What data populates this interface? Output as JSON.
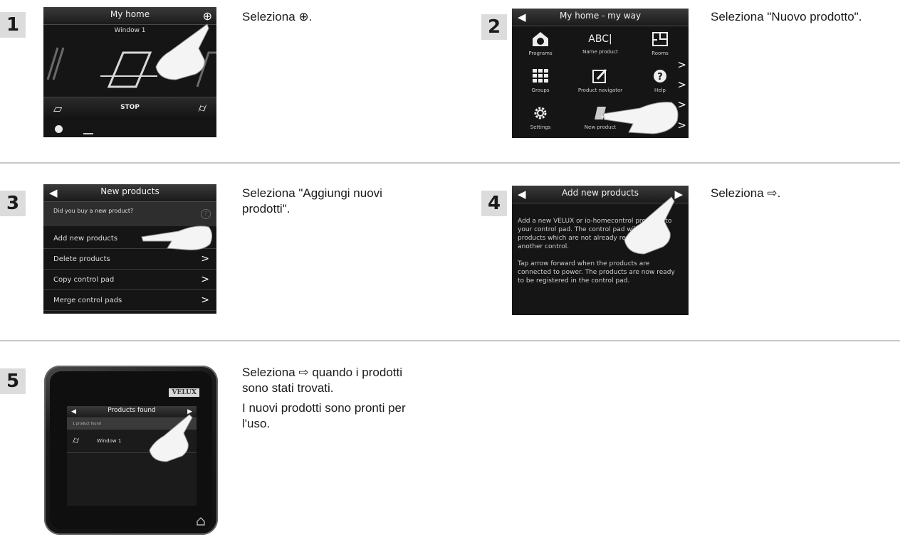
{
  "steps": [
    {
      "number": "1",
      "screen": {
        "title": "My home",
        "subtitle": "Window 1",
        "stop": "STOP"
      },
      "text": [
        "Seleziona ⊕."
      ]
    },
    {
      "number": "2",
      "screen": {
        "title": "My home - my way",
        "items": [
          "Programs",
          "Name product",
          "Rooms",
          "Groups",
          "Product navigator",
          "Help",
          "Settings",
          "New product"
        ],
        "abc": "ABC|"
      },
      "text": [
        "Seleziona \"Nuovo prodotto\"."
      ]
    },
    {
      "number": "3",
      "screen": {
        "title": "New products",
        "question": "Did you buy a new product?",
        "rows": [
          "Add new products",
          "Delete products",
          "Copy control pad",
          "Merge control pads"
        ]
      },
      "text": [
        "Seleziona \"Aggiungi nuovi",
        "prodotti\"."
      ]
    },
    {
      "number": "4",
      "screen": {
        "title": "Add new products",
        "para1": [
          "Add a new VELUX or io-homecontrol products to",
          "your control pad. The control pad will only find",
          "products which are not already registered in",
          "another control."
        ],
        "para2": [
          "Tap arrow forward when the products are",
          "connected to power. The products are now ready",
          "to be registered in the control pad."
        ]
      },
      "text": [
        "Seleziona ⇨."
      ]
    },
    {
      "number": "5",
      "screen": {
        "brand": "VELUX",
        "title": "Products found",
        "status": "1 product found",
        "product": "Window 1"
      },
      "text": [
        "Seleziona ⇨ quando i prodotti",
        "sono stati trovati.",
        "I nuovi prodotti sono pronti per",
        "l'uso."
      ]
    }
  ],
  "colors": {
    "screen_bg": "#151515",
    "badge_bg": "#dcdcdc",
    "separator": "#c8c8c8"
  },
  "icons": [
    "plus-circle-icon",
    "back-arrow-icon",
    "forward-arrow-icon",
    "chevron-right-icon",
    "hand-pointer-icon",
    "clock-icon",
    "home-icon",
    "gear-icon",
    "help-icon"
  ]
}
